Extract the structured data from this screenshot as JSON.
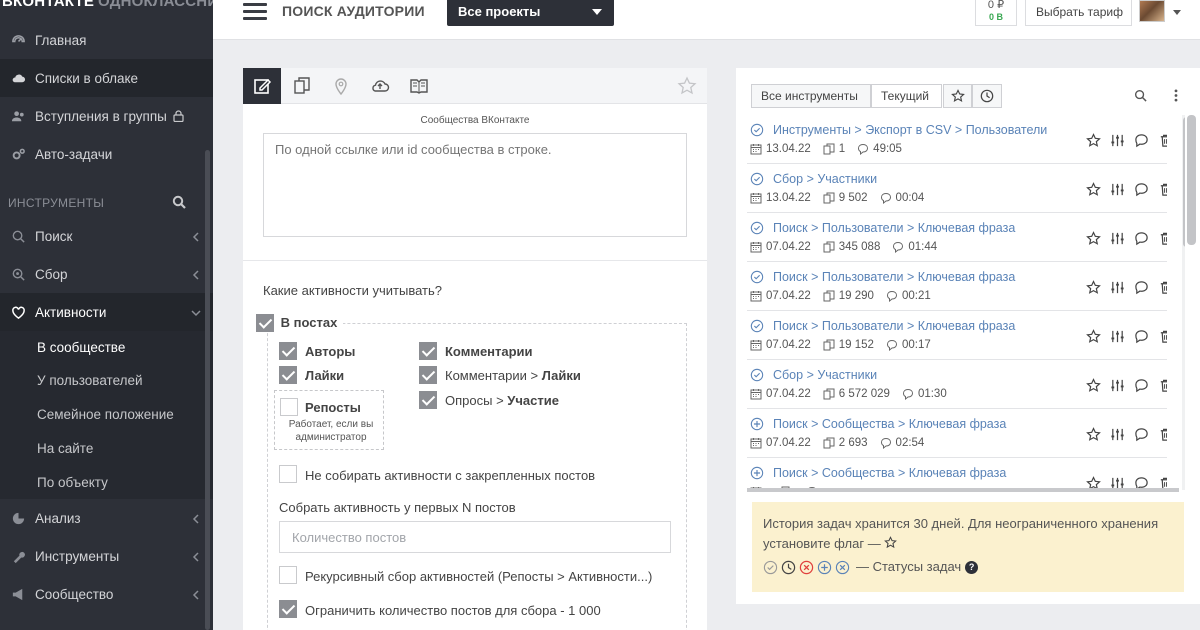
{
  "sidebar": {
    "brand": {
      "primary": "ВКОНТАКТЕ",
      "secondary": "ОДНОКЛАССНИКИ"
    },
    "top_items": [
      {
        "label": "Главная",
        "icon": "dashboard-icon"
      },
      {
        "label": "Списки в облаке",
        "icon": "cloud-icon"
      },
      {
        "label": "Вступления в группы",
        "icon": "users-icon",
        "locked": true
      },
      {
        "label": "Авто-задачи",
        "icon": "gears-icon"
      }
    ],
    "section_title": "ИНСТРУМЕНТЫ",
    "tool_items": [
      {
        "label": "Поиск",
        "icon": "search-icon"
      },
      {
        "label": "Сбор",
        "icon": "target-icon"
      },
      {
        "label": "Активности",
        "icon": "heart-icon",
        "expanded": true
      }
    ],
    "sub_items": [
      {
        "label": "В сообществе",
        "active": true
      },
      {
        "label": "У пользователей"
      },
      {
        "label": "Семейное положение"
      },
      {
        "label": "На сайте"
      },
      {
        "label": "По объекту"
      }
    ],
    "bottom_items": [
      {
        "label": "Анализ",
        "icon": "pie-icon"
      },
      {
        "label": "Инструменты",
        "icon": "wrench-icon"
      },
      {
        "label": "Сообщество",
        "icon": "bullhorn-icon"
      }
    ]
  },
  "topbar": {
    "title": "ПОИСК АУДИТОРИИ",
    "project_select": "Все проекты",
    "balance_top": "0 ₽",
    "balance_bottom": "0 В",
    "tariff_button": "Выбрать тариф"
  },
  "main": {
    "field_label": "Сообщества ВКонтакте",
    "textarea_placeholder": "По одной ссылке или id сообщества в строке.",
    "question": "Какие активности учитывать?",
    "in_posts": "В постах",
    "authors": "Авторы",
    "likes": "Лайки",
    "reposts": "Репосты",
    "reposts_note": "Работает, если вы администратор",
    "comments": "Комментарии",
    "comments_prefix": "Комментарии > ",
    "comments_likes": "Лайки",
    "polls_prefix": "Опросы > ",
    "polls_part": "Участие",
    "no_pinned": "Не собирать активности с закрепленных постов",
    "first_n_title": "Собрать активность у первых N постов",
    "count_placeholder": "Количество постов",
    "recursive": "Рекурсивный сбор активностей (Репосты > Активности...)",
    "limit": "Ограничить количество постов для сбора - 1 000"
  },
  "right": {
    "tab_all": "Все инструменты",
    "tab_current": "Текущий",
    "tasks": [
      {
        "title": "Инструменты > Экспорт в CSV > Пользователи",
        "date": "13.04.22",
        "count": "1",
        "time": "49:05",
        "status": "done"
      },
      {
        "title": "Сбор > Участники",
        "date": "13.04.22",
        "count": "9 502",
        "time": "00:04",
        "status": "done"
      },
      {
        "title": "Поиск > Пользователи > Ключевая фраза",
        "date": "07.04.22",
        "count": "345 088",
        "time": "01:44",
        "status": "done"
      },
      {
        "title": "Поиск > Пользователи > Ключевая фраза",
        "date": "07.04.22",
        "count": "19 290",
        "time": "00:21",
        "status": "done"
      },
      {
        "title": "Поиск > Пользователи > Ключевая фраза",
        "date": "07.04.22",
        "count": "19 152",
        "time": "00:17",
        "status": "done"
      },
      {
        "title": "Сбор > Участники",
        "date": "07.04.22",
        "count": "6 572 029",
        "time": "01:30",
        "status": "done"
      },
      {
        "title": "Поиск > Сообщества > Ключевая фраза",
        "date": "07.04.22",
        "count": "2 693",
        "time": "02:54",
        "status": "added"
      },
      {
        "title": "Поиск > Сообщества > Ключевая фраза",
        "date": "",
        "count": "",
        "time": "",
        "status": "added"
      }
    ],
    "notice_text": "История задач хранится 30 дней. Для неограниченного хранения установите флаг —",
    "statuses_label": "— Статусы задач",
    "help": "?"
  },
  "colors": {
    "sidebar": "#2d3038",
    "link": "#5a83b7",
    "notice": "#fbf1cf",
    "balance_green": "#3aa853",
    "error": "#e0403d"
  }
}
